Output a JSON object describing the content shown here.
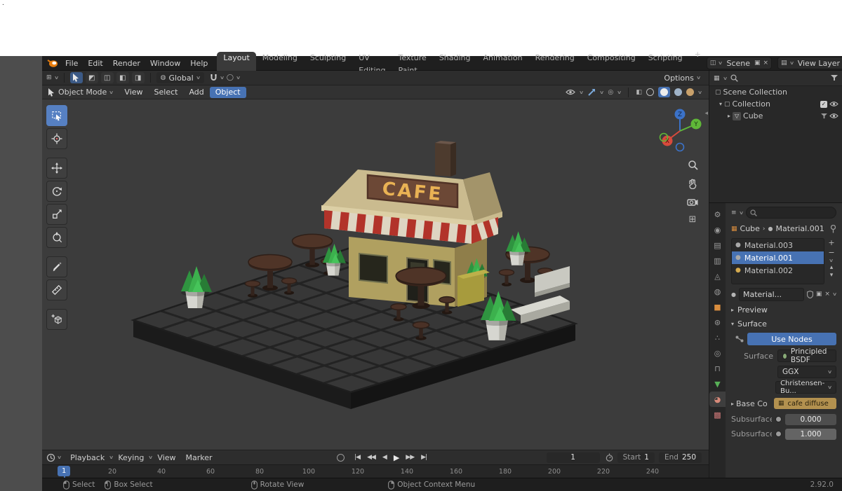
{
  "colors": {
    "accent": "#4772b3",
    "active_tool": "#5680c2",
    "viewport_bg": "#3c3c3c",
    "panel_bg": "#2f2f2f",
    "header_bg": "#1f1f1f",
    "awning_red": "#b2332a",
    "awning_white": "#ded5c2",
    "wall_tan": "#b0a060",
    "sign_brown": "#6c4836",
    "sign_gold": "#e9b254",
    "plant_green": "#3cb14d",
    "base_color_chip": "#b3914f",
    "axis_x": "#d84a3c",
    "axis_y": "#5fb838",
    "axis_z": "#3b72c8"
  },
  "icons": {
    "chevron_down": "∨",
    "breadcrumb_sep": "›",
    "collapse_right": "▸",
    "collapse_down": "▾",
    "plus": "+",
    "minus": "−",
    "close": "×",
    "up_arrow": "▴",
    "down_arrow": "▾",
    "collapse_left": "◂",
    "check": "✓",
    "editor_grid": "⊞",
    "scene_icon": "◫",
    "duplicate": "▣",
    "layers": "▤",
    "outliner_icon": "▦",
    "collection": "▢",
    "mesh": "▽",
    "properties_editor": "≡",
    "object_small": "▦",
    "sphere": "●",
    "image": "▦",
    "orientation_globe": "◍",
    "prop_circle": "◯",
    "overlay": "◎",
    "xray": "◧",
    "grid": "⊞",
    "select_modes": [
      "◩",
      "◫",
      "◧",
      "◨"
    ],
    "tabs": {
      "tool": "⚙",
      "render": "◉",
      "output": "▤",
      "view_layer": "▥",
      "scene": "◬",
      "world": "◍",
      "object": "■",
      "modifiers": "⊛",
      "particles": "∴",
      "physics": "◎",
      "constraints": "⊓",
      "data": "▼",
      "material": "◕",
      "texture": "▩"
    }
  },
  "topbar": {
    "menus": [
      "File",
      "Edit",
      "Render",
      "Window",
      "Help"
    ],
    "workspaces": [
      "Layout",
      "Modeling",
      "Sculpting",
      "UV Editing",
      "Texture Paint",
      "Shading",
      "Animation",
      "Rendering",
      "Compositing",
      "Scripting"
    ],
    "active_workspace": "Layout",
    "add_workspace": "+",
    "scene": {
      "label": "Scene"
    },
    "view_layer": {
      "label": "View Layer"
    }
  },
  "tool_settings": {
    "orientation": "Global",
    "options": "Options"
  },
  "viewport_header": {
    "mode": "Object Mode",
    "menus": [
      "View",
      "Select",
      "Add",
      "Object"
    ],
    "active_menu": "Object"
  },
  "viewport": {
    "cafe_sign": "CAFE",
    "axes": {
      "x": "X",
      "y": "Y",
      "z": "Z"
    }
  },
  "outliner": {
    "scene_collection": "Scene Collection",
    "collection": "Collection",
    "object": "Cube"
  },
  "properties": {
    "breadcrumb": {
      "object": "Cube",
      "material": "Material.001"
    },
    "slots": [
      "Material.003",
      "Material.001",
      "Material.002"
    ],
    "active_slot_index": 1,
    "material_field": "Material...",
    "preview": "Preview",
    "surface": "Surface",
    "use_nodes": "Use Nodes",
    "surface_label": "Surface",
    "surface_value": "Principled BSDF",
    "distribution": "GGX",
    "subsurface_method": "Christensen-Bu...",
    "base_color_label": "Base Co",
    "base_color_value": "cafe diffuse",
    "rows": [
      {
        "label": "Subsurface",
        "value": "0.000"
      },
      {
        "label": "Subsurface ...",
        "value": "1.000"
      }
    ]
  },
  "timeline": {
    "menus": [
      "Playback",
      "Keying",
      "View",
      "Marker"
    ],
    "controls": [
      "|◀",
      "◀◀",
      "◀",
      "▶",
      "▶▶",
      "▶|"
    ],
    "current_frame": "1",
    "frame_value": "1",
    "start_label": "Start",
    "start_value": "1",
    "end_label": "End",
    "end_value": "250",
    "ticks": [
      "20",
      "40",
      "60",
      "80",
      "100",
      "120",
      "140",
      "160",
      "180",
      "200",
      "220",
      "240"
    ]
  },
  "status_bar": {
    "items": [
      "Select",
      "Box Select",
      "Rotate View",
      "Object Context Menu"
    ],
    "version": "2.92.0"
  },
  "page": {
    "corner_mark": "."
  }
}
